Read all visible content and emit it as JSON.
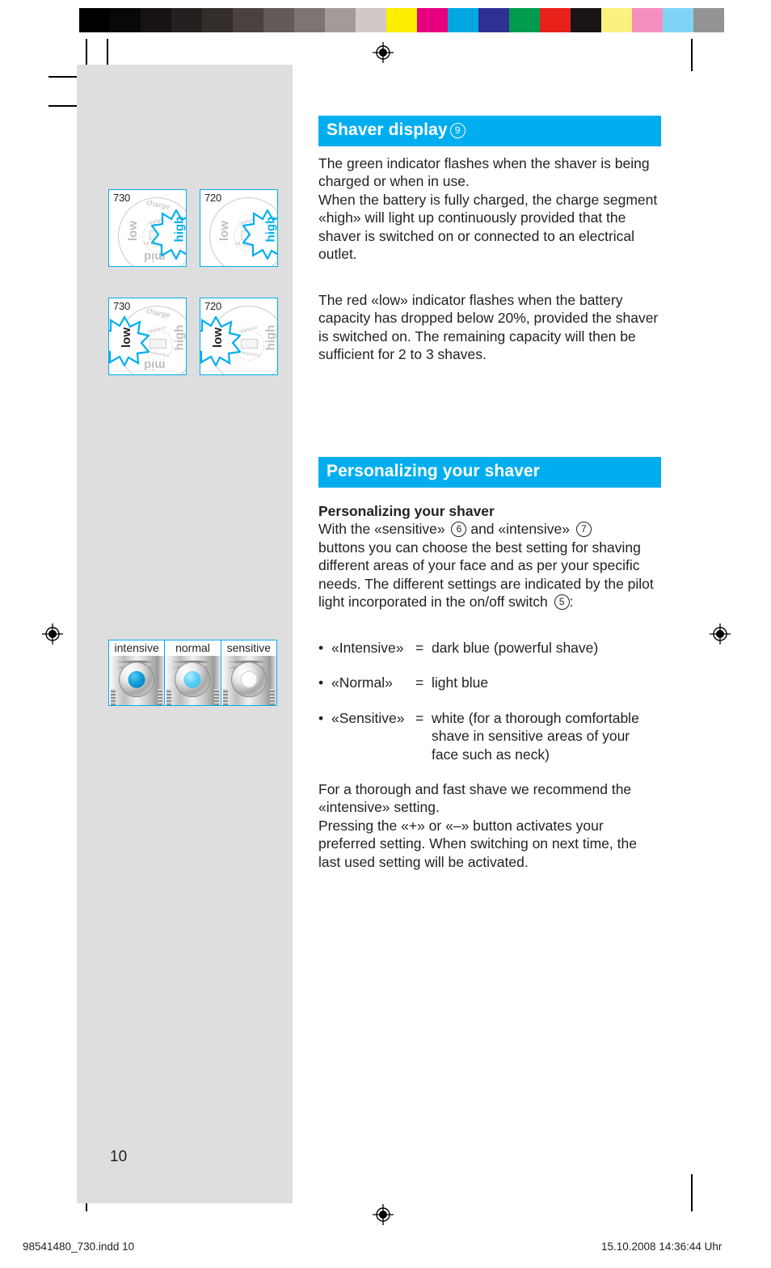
{
  "page": {
    "number": "10",
    "accent_color": "#00aeef",
    "panel_color": "#dedede",
    "text_color": "#231f20"
  },
  "colorbar": {
    "left_swatches": [
      "#000000",
      "#0a0707",
      "#171313",
      "#252020",
      "#332d2b",
      "#4a4240",
      "#635a57",
      "#7e7572",
      "#a49b98",
      "#d2c9c6",
      "#ffffff"
    ],
    "right_swatches": [
      "#ffed00",
      "#e6007e",
      "#00a7e1",
      "#2e3192",
      "#009b4d",
      "#e8211b",
      "#1a1414",
      "#fbf17f",
      "#f48fc0",
      "#7fd4f5",
      "#939393"
    ]
  },
  "sections": [
    {
      "heading": "Shaver display",
      "heading_ref": "9",
      "paragraphs": [
        "The green indicator flashes when the shaver is being charged or when in use.\nWhen the battery is fully charged, the charge segment «high» will light up continuously provided that the shaver is switched on or connected to an electrical outlet.",
        "The red «low» indicator flashes when the battery capacity has dropped below 20%, provided the shaver is switched on. The remaining capacity will then be sufficient for 2 to 3 shaves."
      ]
    },
    {
      "heading": "Personalizing your shaver",
      "heading_ref": "",
      "subheading": "Personalizing your shaver",
      "intro_before_6": "With the «sensitive» ",
      "ref_6": "6",
      "intro_between": " and «intensive» ",
      "ref_7": "7",
      "intro_after": "buttons you can choose the best setting for shaving different areas of your face and as per your specific needs. The different settings are indicated by the pilot light incorporated in the on/off switch ",
      "ref_5": "5",
      "intro_colon": ":",
      "closing": "For a thorough and fast shave we recommend the «intensive» setting.\nPressing the «+» or «–» button activates your preferred setting. When switching on next time, the last used setting will be activated."
    }
  ],
  "bullets": [
    {
      "label": "«Intensive»",
      "equals": "=",
      "value": "dark blue (powerful shave)",
      "value_lines": []
    },
    {
      "label": "«Normal»",
      "equals": "=",
      "value": "light blue",
      "value_lines": []
    },
    {
      "label": "«Sensitive»",
      "equals": "=",
      "value": "white (for a thorough comfortable",
      "value_lines": [
        "shave in sensitive areas of your",
        "face such as neck)"
      ]
    }
  ],
  "figures": {
    "display_panels": [
      {
        "model": "730",
        "top_label": "charge",
        "left_label": "low",
        "bottom_label": "mid",
        "right_label": "high",
        "center_label": "replace",
        "center_sub": "18 months",
        "highlight": "high"
      },
      {
        "model": "720",
        "top_label": "",
        "left_label": "low",
        "bottom_label": "",
        "right_label": "high",
        "center_label": "replace",
        "center_sub": "18 months",
        "highlight": "high"
      },
      {
        "model": "730",
        "top_label": "charge",
        "left_label": "low",
        "bottom_label": "mid",
        "right_label": "high",
        "center_label": "replace",
        "center_sub": "18 months",
        "highlight": "low"
      },
      {
        "model": "720",
        "top_label": "",
        "left_label": "low",
        "bottom_label": "",
        "right_label": "high",
        "center_label": "replace",
        "center_sub": "18 months",
        "highlight": "low"
      }
    ],
    "shaver_heads": [
      {
        "caption": "intensive",
        "light": "dark-blue"
      },
      {
        "caption": "normal",
        "light": "light-blue"
      },
      {
        "caption": "sensitive",
        "light": "white"
      }
    ]
  },
  "footer": {
    "file": "98541480_730.indd   10",
    "timestamp": "15.10.2008   14:36:44 Uhr"
  }
}
